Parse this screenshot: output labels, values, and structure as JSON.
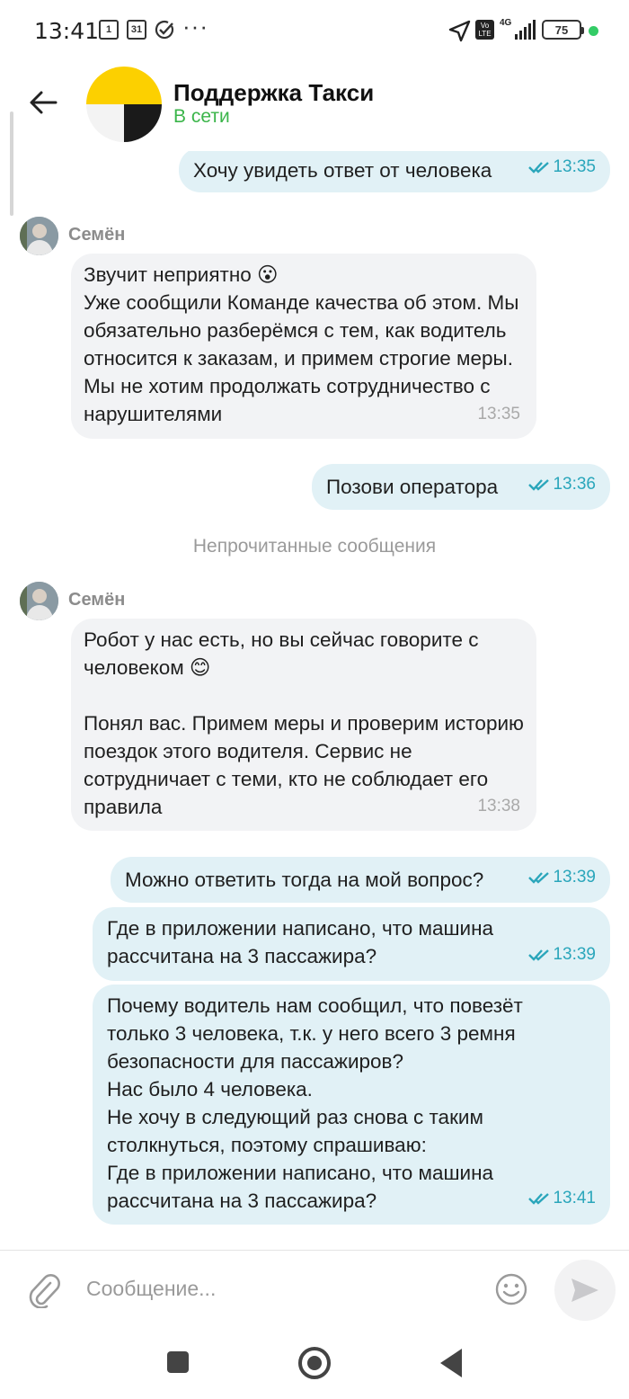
{
  "status_bar": {
    "time": "13:41",
    "icons": [
      "notification-1-icon",
      "calendar-31-icon",
      "check-circle-icon",
      "more-dots-icon",
      "location-arrow-icon",
      "volte-icon",
      "signal-4g-icon",
      "battery-icon"
    ],
    "notification_badge": "1",
    "calendar_day": "31",
    "battery_level": "75",
    "network": "4G",
    "volte": "Vo LTE"
  },
  "header": {
    "title": "Поддержка Такси",
    "status": "В сети",
    "status_color": "#3bb54a"
  },
  "messages": [
    {
      "direction": "out",
      "text": "Хочу увидеть ответ от человека",
      "time": "13:35"
    },
    {
      "direction": "in",
      "sender": "Семён",
      "text": "Звучит неприятно 😮\nУже сообщили Команде качества об этом. Мы обязательно разберёмся с тем, как водитель относится к заказам, и примем строгие меры. Мы не хотим продолжать сотрудничество с нарушителями",
      "time": "13:35"
    },
    {
      "direction": "out",
      "text": "Позови оператора",
      "time": "13:36"
    },
    {
      "direction": "in",
      "sender": "Семён",
      "text": "Робот у нас есть, но вы сейчас говорите с человеком 😊\n\nПонял вас. Примем меры и проверим историю поездок этого водителя. Сервис не сотрудничает с теми, кто не соблюдает его правила",
      "time": "13:38"
    },
    {
      "direction": "out",
      "text": "Можно ответить тогда на мой вопрос?",
      "time": "13:39"
    },
    {
      "direction": "out",
      "text": "Где в приложении написано, что машина рассчитана на 3 пассажира?",
      "time": "13:39"
    },
    {
      "direction": "out",
      "text": "Почему водитель нам сообщил, что повезёт только 3 человека, т.к. у него всего 3 ремня безопасности для пассажиров?\nНас было 4 человека.\nНе хочу в следующий раз снова с таким столкнуться, поэтому спрашиваю:\nГде в приложении написано, что машина рассчитана на 3 пассажира?",
      "time": "13:41"
    }
  ],
  "unread_divider": "Непрочитанные сообщения",
  "composer": {
    "placeholder": "Сообщение..."
  },
  "colors": {
    "incoming_bubble": "#f2f3f5",
    "outgoing_bubble": "#e1f1f6",
    "time_out": "#2aa6bb",
    "time_in": "#a9a9a9"
  }
}
